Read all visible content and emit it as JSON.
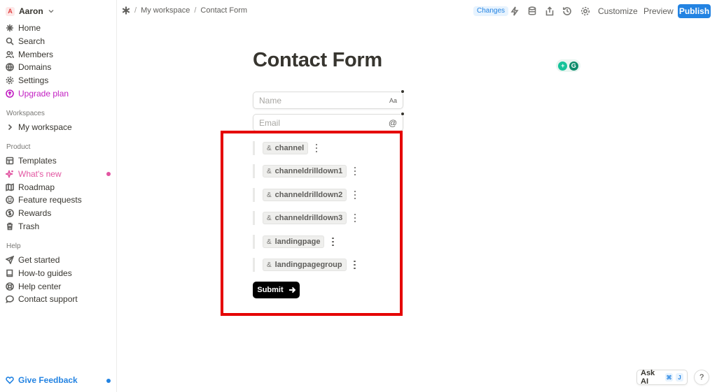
{
  "sidebar": {
    "user": {
      "avatar_letter": "A",
      "name": "Aaron"
    },
    "nav": [
      {
        "label": "Home",
        "icon": "home-icon"
      },
      {
        "label": "Search",
        "icon": "search-icon"
      },
      {
        "label": "Members",
        "icon": "members-icon"
      },
      {
        "label": "Domains",
        "icon": "globe-icon"
      },
      {
        "label": "Settings",
        "icon": "gear-icon"
      },
      {
        "label": "Upgrade plan",
        "icon": "upgrade-icon",
        "accent": "#c21ec2"
      }
    ],
    "workspaces_label": "Workspaces",
    "workspace": "My workspace",
    "product_label": "Product",
    "product": [
      {
        "label": "Templates",
        "icon": "templates-icon"
      },
      {
        "label": "What's new",
        "icon": "sparkle-icon",
        "accent": "#e255a1"
      },
      {
        "label": "Roadmap",
        "icon": "map-icon"
      },
      {
        "label": "Feature requests",
        "icon": "smile-icon"
      },
      {
        "label": "Rewards",
        "icon": "dollar-icon"
      },
      {
        "label": "Trash",
        "icon": "trash-icon"
      }
    ],
    "help_label": "Help",
    "help": [
      {
        "label": "Get started",
        "icon": "send-icon"
      },
      {
        "label": "How-to guides",
        "icon": "book-icon"
      },
      {
        "label": "Help center",
        "icon": "lifebuoy-icon"
      },
      {
        "label": "Contact support",
        "icon": "chat-icon"
      }
    ],
    "feedback": "Give Feedback"
  },
  "topbar": {
    "breadcrumb": [
      "My workspace",
      "Contact Form"
    ],
    "changes": "Changes",
    "customize": "Customize",
    "preview": "Preview",
    "publish": "Publish",
    "accent": "#2383e2"
  },
  "form": {
    "title": "Contact Form",
    "fields": [
      {
        "placeholder": "Name",
        "icon_text": "Aa"
      },
      {
        "placeholder": "Email",
        "icon_text": "@"
      }
    ],
    "hidden_fields": [
      "channel",
      "channeldrilldown1",
      "channeldrilldown2",
      "channeldrilldown3",
      "landingpage",
      "landingpagegroup"
    ],
    "hidden_prefix": "&",
    "submit": "Submit"
  },
  "footer": {
    "ask_ai": "Ask AI",
    "shortcut_keys": [
      "⌘",
      "J"
    ],
    "help": "?"
  },
  "grammarly": {
    "letter": "G"
  }
}
